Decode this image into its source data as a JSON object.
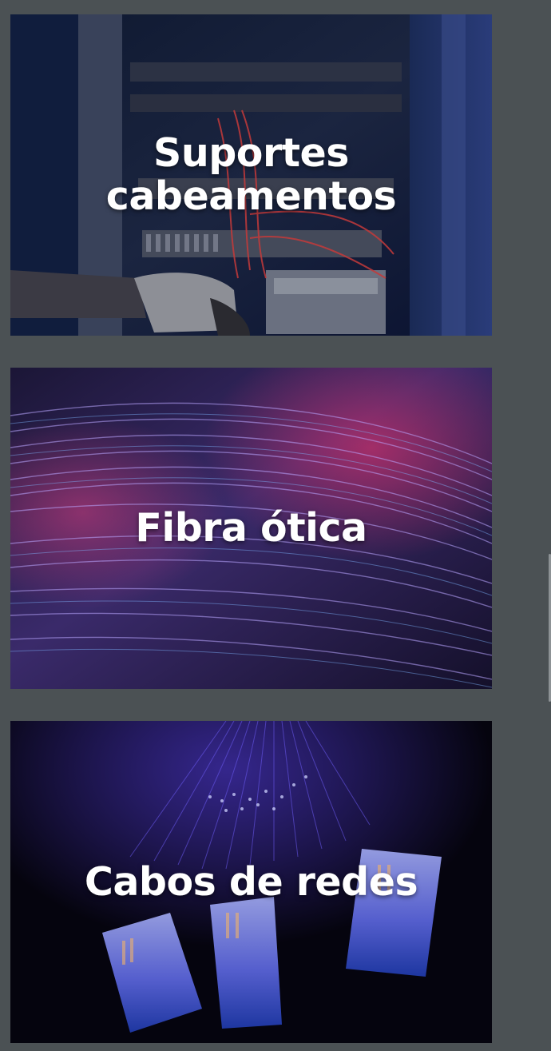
{
  "cards": [
    {
      "title": "Suportes\ncabeamentos",
      "image": "server-rack-cabling-photo"
    },
    {
      "title": "Fibra ótica",
      "image": "fiber-optic-strands-photo"
    },
    {
      "title": "Cabos de redes",
      "image": "network-cable-connectors-photo"
    }
  ],
  "colors": {
    "page_background": "#4b5154",
    "title_text": "#ffffff"
  }
}
